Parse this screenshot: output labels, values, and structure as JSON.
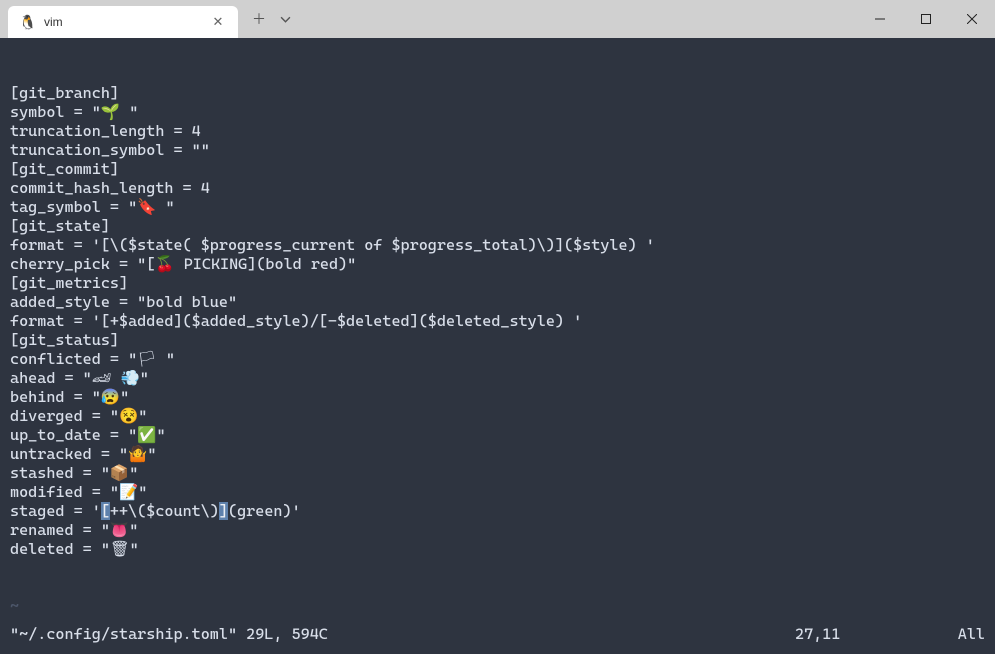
{
  "window": {
    "tab_title": "vim",
    "tab_icon": "🐧"
  },
  "editor": {
    "lines": [
      "[git_branch]",
      "symbol = \"🌱 \"",
      "truncation_length = 4",
      "truncation_symbol = \"\"",
      "",
      "[git_commit]",
      "commit_hash_length = 4",
      "tag_symbol = \"🔖 \"",
      "",
      "[git_state]",
      "format = '[\\($state( $progress_current of $progress_total)\\)]($style) '",
      "cherry_pick = \"[🍒 PICKING](bold red)\"",
      "",
      "[git_metrics]",
      "added_style = \"bold blue\"",
      "format = '[+$added]($added_style)/[-$deleted]($deleted_style) '",
      "",
      "[git_status]",
      "conflicted = \"🏳 \"",
      "ahead = \"🏎 💨\"",
      "behind = \"😰\"",
      "diverged = \"😵\"",
      "up_to_date = \"✅\"",
      "untracked = \"🤷\"",
      "stashed = \"📦\"",
      "modified = \"📝\"",
      "staged = '[++\\($count\\)](green)'",
      "renamed = \"👅\"",
      "deleted = \"🗑\""
    ],
    "tilde": "~",
    "status_file": "\"~/.config/starship.toml\" 29L, 594C",
    "status_position": "27,11",
    "status_percent": "All"
  }
}
